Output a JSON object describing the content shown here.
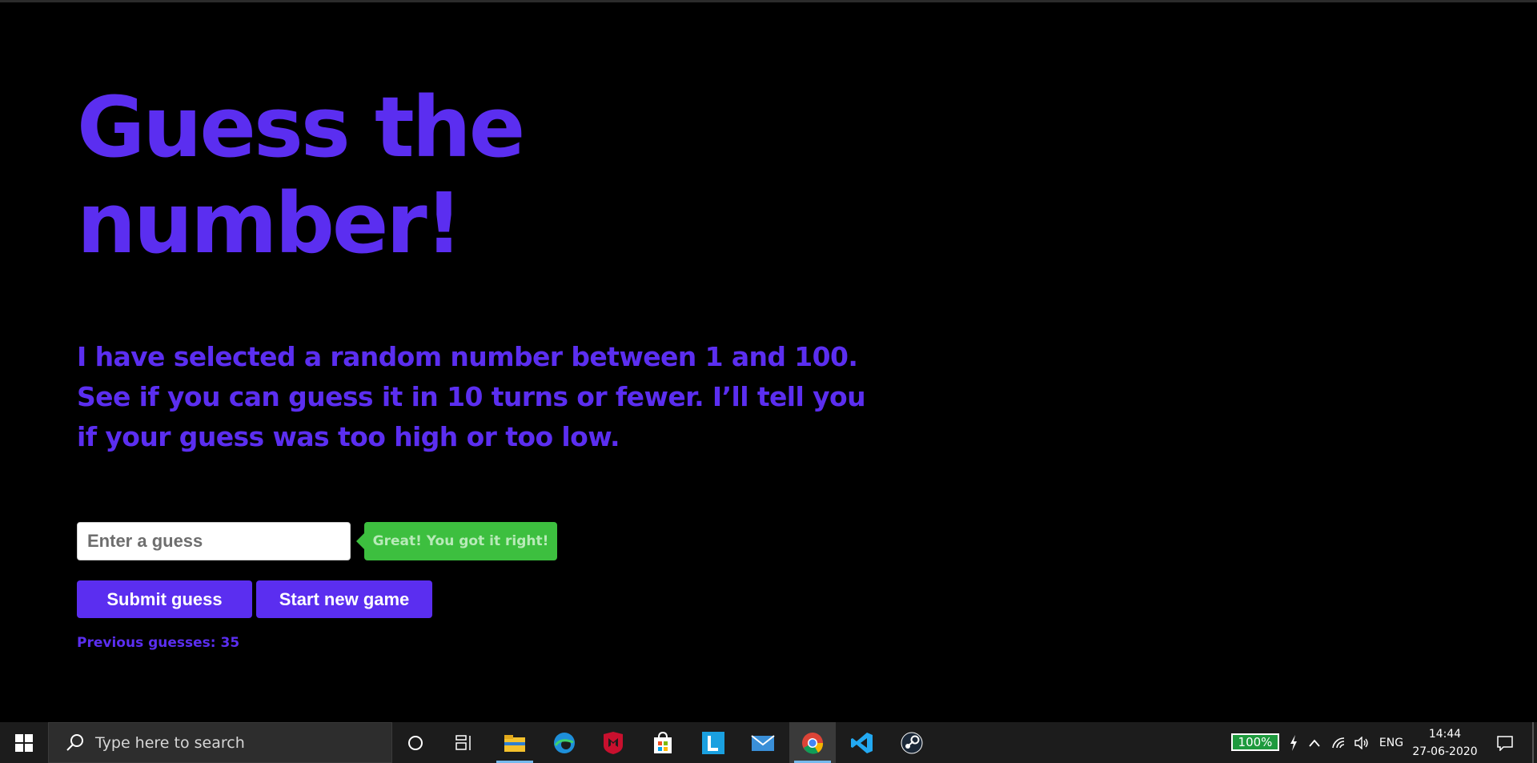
{
  "page": {
    "title": "Guess the number!",
    "intro": "I have selected a random number between 1 and 100. See if you can guess it in 10 turns or fewer. I’ll tell you if your guess was too high or too low.",
    "guess_input": {
      "placeholder": "Enter a guess",
      "value": ""
    },
    "result_message": "Great! You got it right!",
    "submit_label": "Submit guess",
    "new_game_label": "Start new game",
    "previous_guesses": "Previous guesses: 35"
  },
  "colors": {
    "accent": "#5b2ef0",
    "success": "#3dbf3f",
    "background": "#000000"
  },
  "taskbar": {
    "search_placeholder": "Type here to search",
    "apps": [
      "cortana-icon",
      "task-view-icon",
      "file-explorer-icon",
      "edge-icon",
      "mcafee-icon",
      "store-icon",
      "app-l-icon",
      "mail-icon",
      "chrome-icon",
      "vscode-icon",
      "steam-icon"
    ],
    "battery": "100%",
    "language": "ENG",
    "time": "14:44",
    "date": "27-06-2020"
  }
}
